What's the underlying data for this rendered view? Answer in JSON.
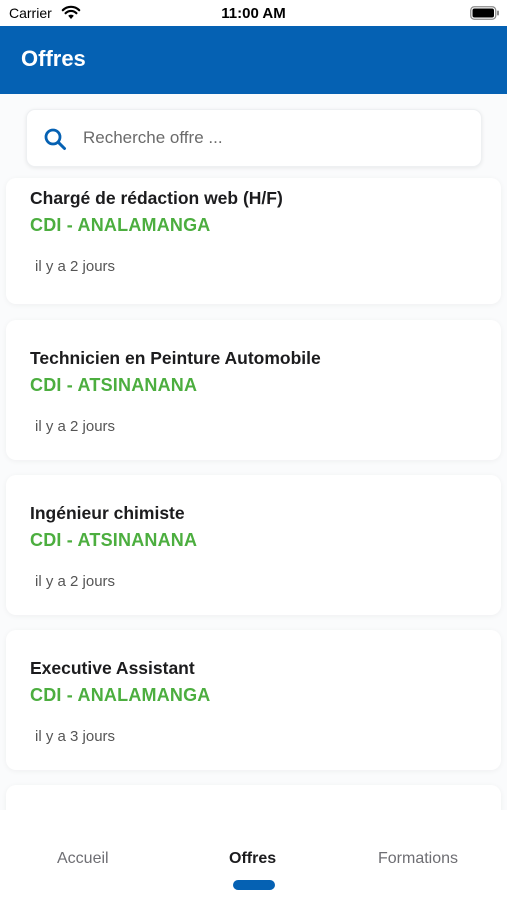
{
  "status_bar": {
    "carrier": "Carrier",
    "time": "11:00 AM",
    "wifi_icon": "wifi-icon",
    "battery_icon": "battery-icon"
  },
  "header": {
    "title": "Offres",
    "background_color": "#0561b3"
  },
  "search": {
    "placeholder": "Recherche offre ...",
    "value": "",
    "icon": "search-icon"
  },
  "offers": [
    {
      "title": "Chargé de rédaction web (H/F)",
      "contract": "CDI - ANALAMANGA",
      "posted": "il y a 2 jours"
    },
    {
      "title": "Technicien en Peinture Automobile",
      "contract": "CDI - ATSINANANA",
      "posted": "il y a 2 jours"
    },
    {
      "title": "Ingénieur chimiste",
      "contract": "CDI - ATSINANANA",
      "posted": "il y a 2 jours"
    },
    {
      "title": "Executive Assistant",
      "contract": "CDI - ANALAMANGA",
      "posted": "il y a 3 jours"
    },
    {
      "title": "",
      "contract": "",
      "posted": ""
    }
  ],
  "tabs": [
    {
      "label": "Accueil",
      "active": false
    },
    {
      "label": "Offres",
      "active": true
    },
    {
      "label": "Formations",
      "active": false
    }
  ],
  "colors": {
    "accent": "#0561b3",
    "contract_green": "#4cae3f"
  }
}
